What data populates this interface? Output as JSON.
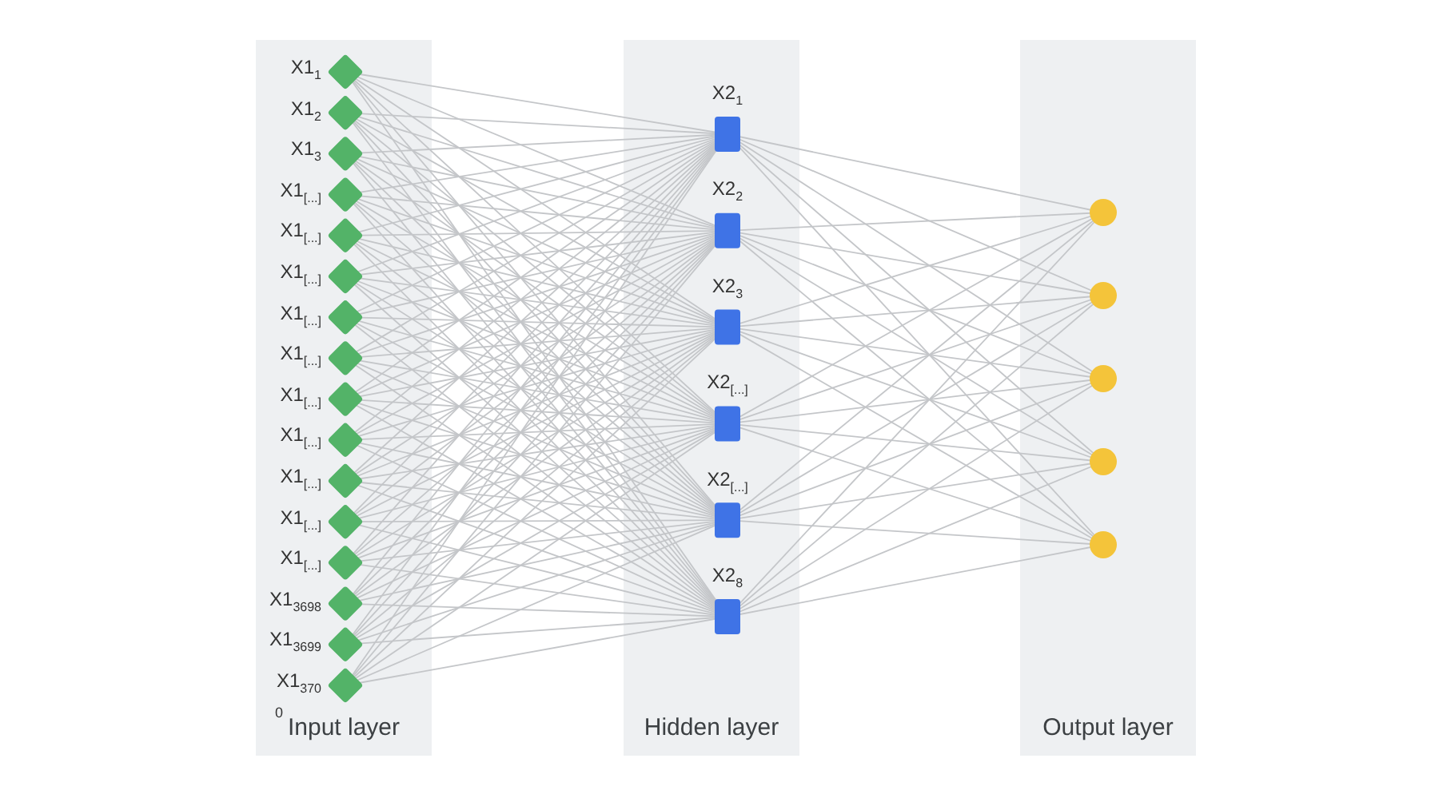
{
  "layers": [
    {
      "kind": "input",
      "title": "Input layer",
      "nodes": [
        {
          "kind": "diamond",
          "label": "X1$_{1}$"
        },
        {
          "kind": "diamond",
          "label": "X1$_{2}$"
        },
        {
          "kind": "diamond",
          "label": "X1$_{3}$"
        },
        {
          "kind": "diamond",
          "label": "X1$_{[...]}$"
        },
        {
          "kind": "diamond",
          "label": "X1$_{[...]}$"
        },
        {
          "kind": "diamond",
          "label": "X1$_{[...]}$"
        },
        {
          "kind": "diamond",
          "label": "X1$_{[...]}$"
        },
        {
          "kind": "diamond",
          "label": "X1$_{[...]}$"
        },
        {
          "kind": "diamond",
          "label": "X1$_{[...]}$"
        },
        {
          "kind": "diamond",
          "label": "X1$_{[...]}$"
        },
        {
          "kind": "diamond",
          "label": "X1$_{[...]}$"
        },
        {
          "kind": "diamond",
          "label": "X1$_{[...]}$"
        },
        {
          "kind": "diamond",
          "label": "X1$_{[...]}$"
        },
        {
          "kind": "diamond",
          "label": "X1$_{3698}$"
        },
        {
          "kind": "diamond",
          "label": "X1$_{3699}$"
        },
        {
          "kind": "diamond",
          "label": "X1$_{370}$"
        }
      ],
      "overflow_text": "0"
    },
    {
      "kind": "hidden",
      "title": "Hidden layer",
      "nodes": [
        {
          "kind": "square",
          "label": "X2$_{1}$"
        },
        {
          "kind": "square",
          "label": "X2$_{2}$"
        },
        {
          "kind": "square",
          "label": "X2$_{3}$"
        },
        {
          "kind": "square",
          "label": "X2$_{[...]}$"
        },
        {
          "kind": "square",
          "label": "X2$_{[...]}$"
        },
        {
          "kind": "square",
          "label": "X2$_{8}$"
        }
      ]
    },
    {
      "kind": "output",
      "title": "Output layer",
      "nodes": [
        {
          "kind": "circle"
        },
        {
          "kind": "circle"
        },
        {
          "kind": "circle"
        },
        {
          "kind": "circle"
        },
        {
          "kind": "circle"
        }
      ]
    }
  ]
}
